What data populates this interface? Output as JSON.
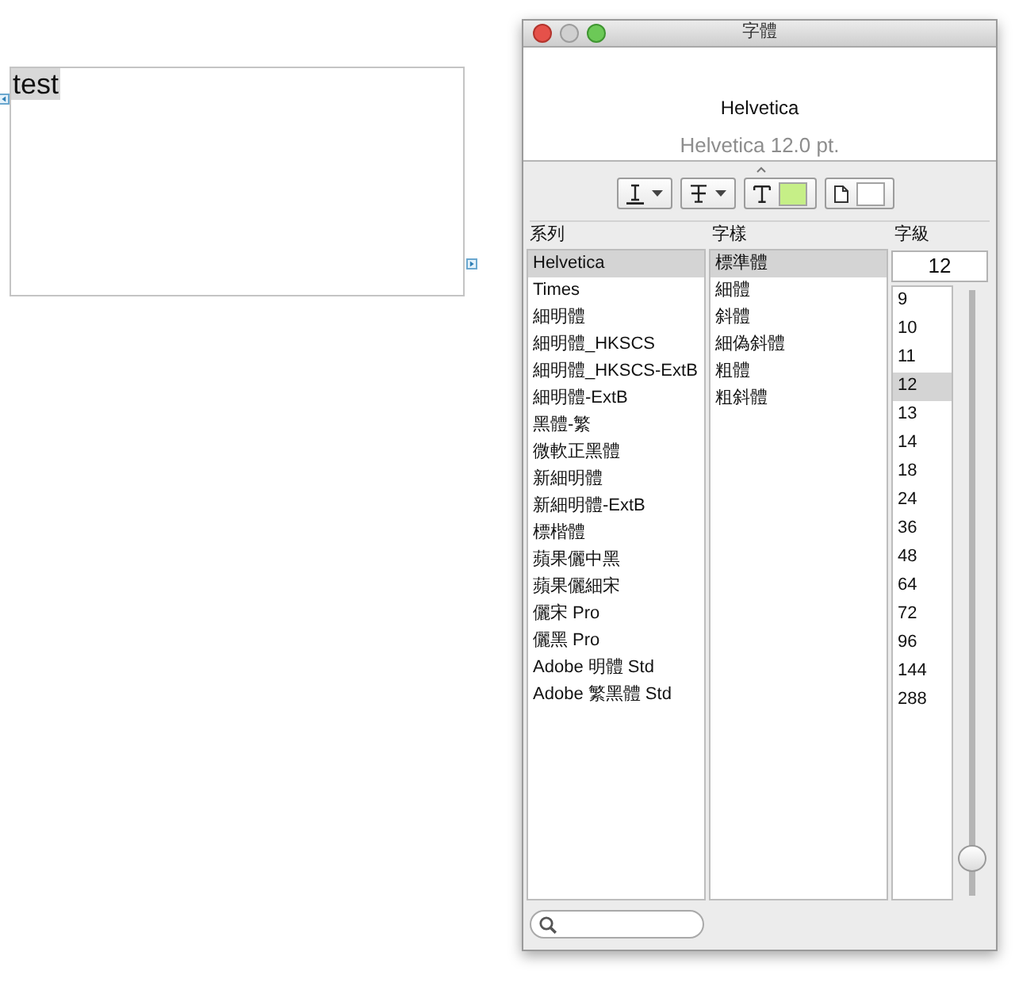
{
  "window": {
    "title": "字體"
  },
  "document": {
    "text": "test",
    "selected": true
  },
  "preview": {
    "font_name": "Helvetica",
    "description": "Helvetica 12.0 pt."
  },
  "toolbar": [
    {
      "kind": "underline"
    },
    {
      "kind": "strikethrough"
    },
    {
      "kind": "text_color",
      "color": "#c6ef87"
    },
    {
      "kind": "document_color",
      "color": "#ffffff"
    }
  ],
  "family": {
    "header": "系列",
    "items": [
      {
        "label": "Helvetica",
        "selected": true
      },
      {
        "label": "Times",
        "selected": false
      },
      {
        "label": "細明體",
        "selected": false
      },
      {
        "label": "細明體_HKSCS",
        "selected": false
      },
      {
        "label": "細明體_HKSCS-ExtB",
        "selected": false
      },
      {
        "label": "細明體-ExtB",
        "selected": false
      },
      {
        "label": "黑體-繁",
        "selected": false
      },
      {
        "label": "微軟正黑體",
        "selected": false
      },
      {
        "label": "新細明體",
        "selected": false
      },
      {
        "label": "新細明體-ExtB",
        "selected": false
      },
      {
        "label": "標楷體",
        "selected": false
      },
      {
        "label": "蘋果儷中黑",
        "selected": false
      },
      {
        "label": "蘋果儷細宋",
        "selected": false
      },
      {
        "label": "儷宋 Pro",
        "selected": false
      },
      {
        "label": "儷黑 Pro",
        "selected": false
      },
      {
        "label": "Adobe 明體 Std",
        "selected": false
      },
      {
        "label": "Adobe 繁黑體 Std",
        "selected": false
      }
    ]
  },
  "typeface": {
    "header": "字樣",
    "items": [
      {
        "label": "標準體",
        "selected": true
      },
      {
        "label": "細體",
        "selected": false
      },
      {
        "label": "斜體",
        "selected": false
      },
      {
        "label": "細偽斜體",
        "selected": false
      },
      {
        "label": "粗體",
        "selected": false
      },
      {
        "label": "粗斜體",
        "selected": false
      }
    ]
  },
  "size": {
    "header": "字級",
    "value": "12",
    "items": [
      {
        "label": "9",
        "selected": false
      },
      {
        "label": "10",
        "selected": false
      },
      {
        "label": "11",
        "selected": false
      },
      {
        "label": "12",
        "selected": true
      },
      {
        "label": "13",
        "selected": false
      },
      {
        "label": "14",
        "selected": false
      },
      {
        "label": "18",
        "selected": false
      },
      {
        "label": "24",
        "selected": false
      },
      {
        "label": "36",
        "selected": false
      },
      {
        "label": "48",
        "selected": false
      },
      {
        "label": "64",
        "selected": false
      },
      {
        "label": "72",
        "selected": false
      },
      {
        "label": "96",
        "selected": false
      },
      {
        "label": "144",
        "selected": false
      },
      {
        "label": "288",
        "selected": false
      }
    ],
    "slider": {
      "level": 0.04
    }
  }
}
